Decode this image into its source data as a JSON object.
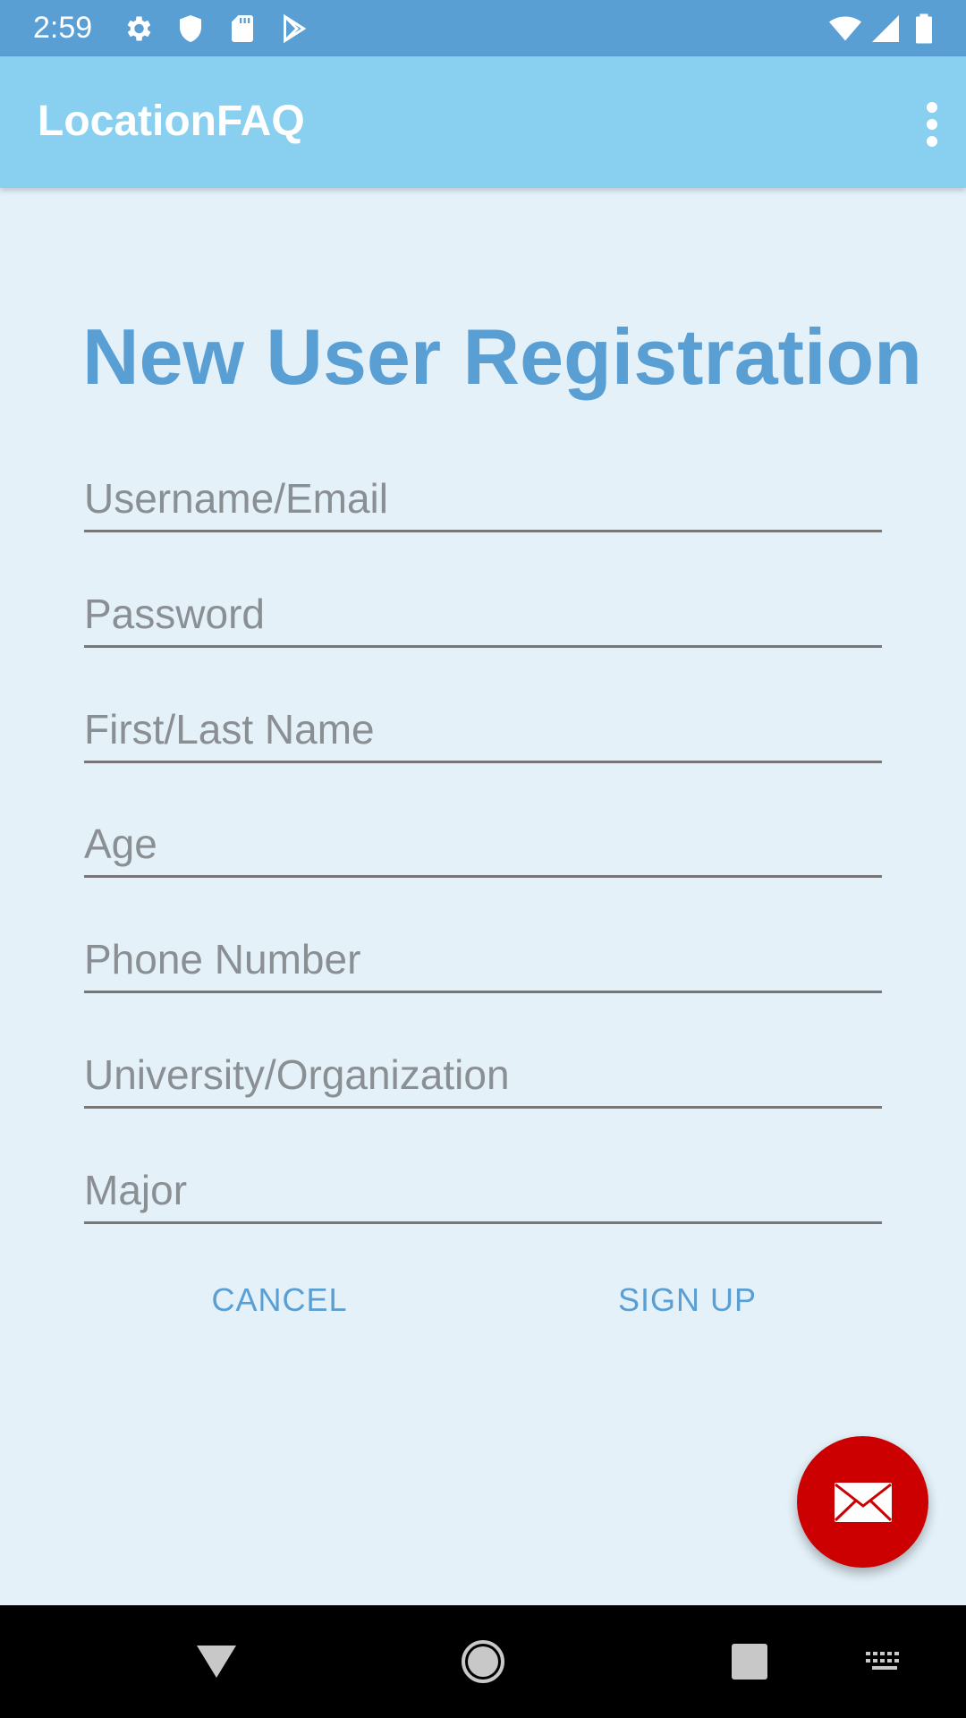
{
  "status_bar": {
    "time": "2:59",
    "icons": [
      "gear-icon",
      "shield-icon",
      "sd-card-icon",
      "play-store-icon",
      "wifi-icon",
      "signal-icon",
      "battery-icon"
    ]
  },
  "app_bar": {
    "title": "LocationFAQ",
    "menu_icon": "more-vert-icon"
  },
  "form": {
    "title": "New User Registration",
    "fields": [
      {
        "placeholder": "Username/Email",
        "value": ""
      },
      {
        "placeholder": "Password",
        "value": ""
      },
      {
        "placeholder": "First/Last Name",
        "value": ""
      },
      {
        "placeholder": "Age",
        "value": ""
      },
      {
        "placeholder": "Phone Number",
        "value": ""
      },
      {
        "placeholder": "University/Organization",
        "value": ""
      },
      {
        "placeholder": "Major",
        "value": ""
      }
    ],
    "cancel_label": "CANCEL",
    "signup_label": "SIGN UP"
  },
  "fab": {
    "icon": "email-icon"
  },
  "nav_bar": {
    "icons": [
      "back-icon",
      "home-icon",
      "recents-icon",
      "keyboard-icon"
    ]
  },
  "colors": {
    "status_bar": "#5a9fd4",
    "app_bar": "#89cff0",
    "background": "#e4f1f9",
    "accent": "#5a9fd4",
    "fab": "#cc0000"
  }
}
